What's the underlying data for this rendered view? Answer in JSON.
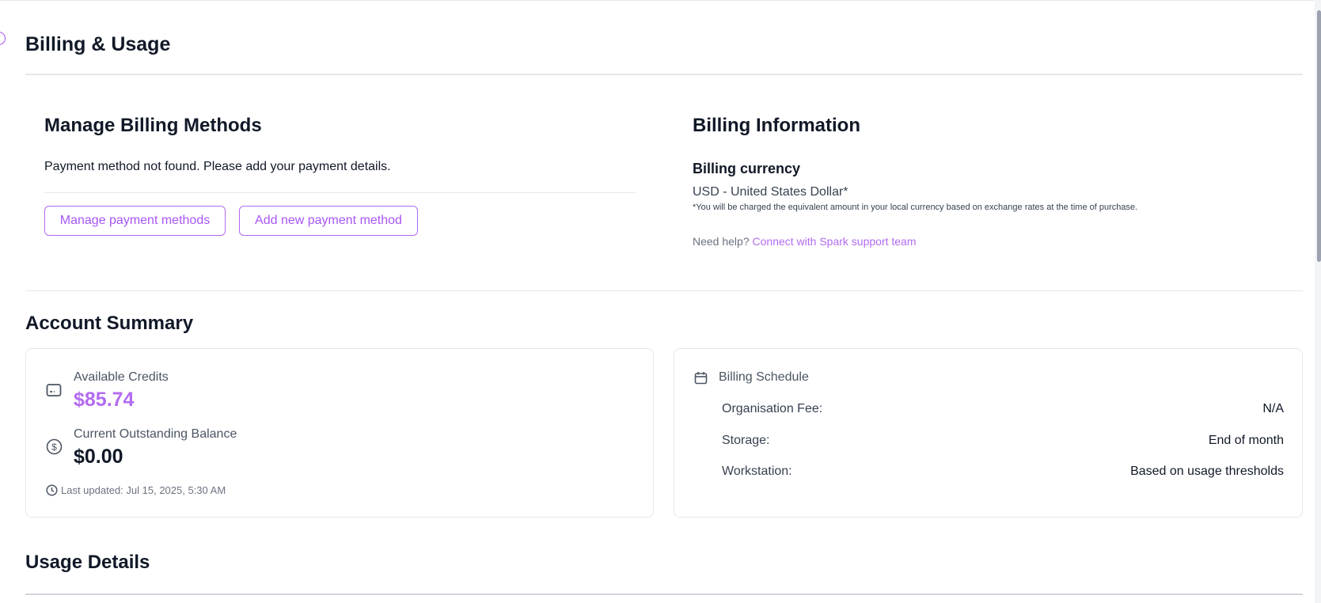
{
  "page": {
    "title": "Billing & Usage"
  },
  "billing_methods": {
    "title": "Manage Billing Methods",
    "message": "Payment method not found. Please add your payment details.",
    "manage_button": "Manage payment methods",
    "add_button": "Add new payment method"
  },
  "billing_info": {
    "title": "Billing Information",
    "currency_label": "Billing currency",
    "currency_value": "USD - United States Dollar*",
    "footnote": "*You will be charged the equivalent amount in your local currency based on exchange rates at the time of purchase.",
    "help_text": "Need help?",
    "help_link": "Connect with Spark support team"
  },
  "account_summary": {
    "title": "Account Summary",
    "credits_label": "Available Credits",
    "credits_value": "$85.74",
    "balance_label": "Current Outstanding Balance",
    "balance_value": "$0.00",
    "last_updated": "Last updated: Jul 15, 2025, 5:30 AM",
    "schedule_title": "Billing Schedule",
    "schedule": [
      {
        "label": "Organisation Fee:",
        "value": "N/A"
      },
      {
        "label": "Storage:",
        "value": "End of month"
      },
      {
        "label": "Workstation:",
        "value": "Based on usage thresholds"
      }
    ]
  },
  "usage": {
    "title": "Usage Details"
  },
  "colors": {
    "accent": "#b36bf0",
    "text": "#111827",
    "border": "#e5e7eb"
  }
}
